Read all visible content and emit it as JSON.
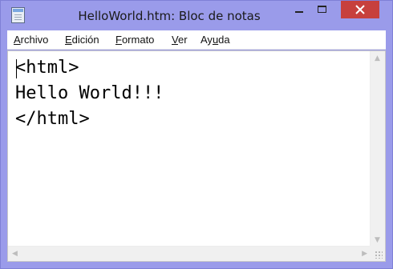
{
  "window": {
    "title": "HelloWorld.htm: Bloc de notas",
    "accent_color": "#9a9bea",
    "close_color": "#c7403d",
    "icon": "notepad-icon"
  },
  "menu": {
    "items": [
      {
        "mnemonic": "A",
        "rest": "rchivo"
      },
      {
        "mnemonic": "E",
        "rest": "dición"
      },
      {
        "mnemonic": "F",
        "rest": "ormato"
      },
      {
        "mnemonic": "V",
        "rest": "er"
      },
      {
        "pre": "Ay",
        "mnemonic": "u",
        "rest": "da"
      }
    ]
  },
  "editor": {
    "lines": [
      "<html>",
      "Hello World!!!",
      "</html>"
    ]
  }
}
